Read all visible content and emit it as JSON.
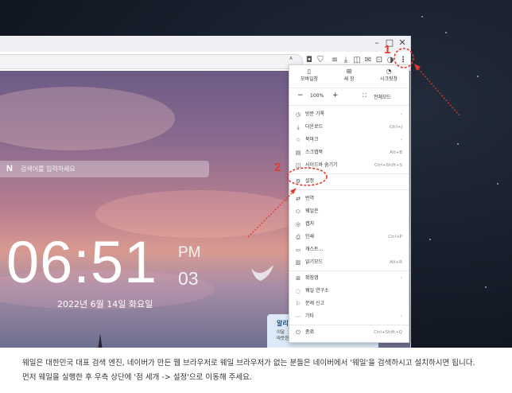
{
  "window": {
    "minimize": "–",
    "maximize": "□",
    "close": "✕"
  },
  "address_bar": {
    "icon": "translate-icon"
  },
  "toolbar_icons": [
    "camera-icon",
    "shield-icon",
    "filter-icon",
    "download-icon",
    "tabs-icon",
    "mail-icon",
    "screenshot-icon",
    "sidebar-icon",
    "extension-icon",
    "more-menu-icon"
  ],
  "newtab": {
    "search_logo": "N",
    "search_placeholder": "검색어를 입력하세요",
    "time": "06:51",
    "ampm": "PM",
    "seconds": "03",
    "date": "2022년 6월 14일 화요일",
    "page_dots": "●●●"
  },
  "menu": {
    "top_buttons": [
      {
        "icon": "▯",
        "label": "모바일창"
      },
      {
        "icon": "⊞",
        "label": "새 창"
      },
      {
        "icon": "◔",
        "label": "시크릿창"
      }
    ],
    "zoom": {
      "minus": "−",
      "value": "100%",
      "plus": "+",
      "fullscreen_icon": "⛶",
      "fullscreen_label": "전체모드"
    },
    "items": [
      {
        "icon": "◷",
        "label": "방문 기록",
        "shortcut": "›"
      },
      {
        "icon": "⤓",
        "label": "다운로드",
        "shortcut": "Ctrl+J"
      },
      {
        "icon": "☆",
        "label": "북마크",
        "shortcut": "›"
      },
      {
        "icon": "▤",
        "label": "스크랩북",
        "shortcut": "Alt+B"
      },
      {
        "icon": "◫",
        "label": "사이드바 숨기기",
        "shortcut": "Ctrl+Shift+S"
      },
      {
        "icon": "⚙",
        "label": "설정",
        "shortcut": ""
      },
      {
        "icon": "⇄",
        "label": "번역",
        "shortcut": ""
      },
      {
        "icon": "⬭",
        "label": "웨일온",
        "shortcut": ""
      },
      {
        "icon": "◎",
        "label": "캡처",
        "shortcut": ""
      },
      {
        "icon": "⎙",
        "label": "인쇄",
        "shortcut": "Ctrl+P"
      },
      {
        "icon": "▭",
        "label": "캐스트...",
        "shortcut": ""
      },
      {
        "icon": "▥",
        "label": "읽기모드",
        "shortcut": "Alt+R"
      },
      {
        "icon": "⊞",
        "label": "확장앱",
        "shortcut": "›"
      },
      {
        "icon": "◌",
        "label": "웨일 연구소",
        "shortcut": ""
      },
      {
        "icon": "⚐",
        "label": "문제 신고",
        "shortcut": ""
      },
      {
        "icon": "⋯",
        "label": "기타",
        "shortcut": "›"
      },
      {
        "icon": "⏻",
        "label": "종료",
        "shortcut": "Ctrl+Shift+Q"
      }
    ]
  },
  "toast": {
    "title": "알리",
    "line1": "이달",
    "line2": "따뜻한 '알리스토르 배경을 바꿔보세요"
  },
  "annotations": {
    "marker_1": "1",
    "marker_2": "2",
    "color": "#e23a2a"
  },
  "caption": {
    "line1": "웨일은 대한민국 대표 검색 엔진, 네이버가 만든 웹 브라우저로 웨일 브라우저가 없는 분들은 네이버에서 '웨일'을 검색하시고 설치하시면 됩니다.",
    "line2": "먼저 웨일을 실행한 후 우측 상단에 '점 세개 -> 설정'으로 이동해 주세요."
  }
}
